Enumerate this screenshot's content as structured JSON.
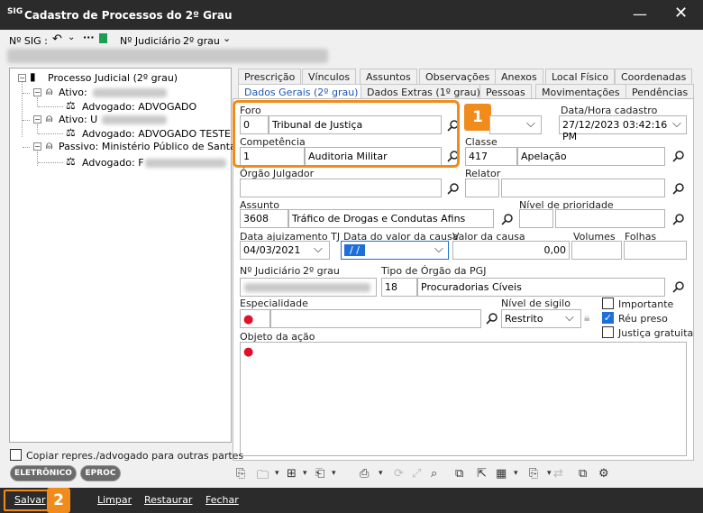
{
  "window": {
    "logo": "SIG",
    "title": "Cadastro de Processos do 2º Grau",
    "min": "—",
    "close": "✕"
  },
  "topbar": {
    "sig_label": "Nº SIG :",
    "judiciario_label": "Nº Judiciário",
    "grau_label": "2º grau"
  },
  "tree": {
    "root": "Processo Judicial (2º grau)",
    "ativo1": "Ativo:",
    "adv1": "Advogado: ADVOGADO",
    "ativo2": "Ativo: U",
    "adv2": "Advogado: ADVOGADO TESTE",
    "passivo": "Passivo: Ministério Público de Santa",
    "adv3": "Advogado: F"
  },
  "tabs_row1": [
    "Prescrição",
    "Vínculos",
    "Assuntos",
    "Observações",
    "Anexos",
    "Local Físico",
    "Coordenadas"
  ],
  "tabs_row2": [
    "Dados Gerais (2º grau)",
    "Dados Extras (1º grau)",
    "Pessoas",
    "Movimentações",
    "Pendências"
  ],
  "form": {
    "foro_label": "Foro",
    "foro_code": "0",
    "foro_name": "Tribunal de Justiça",
    "competencia_label": "Competência",
    "competencia_code": "1",
    "competencia_name": "Auditoria Militar",
    "datahora_label": "Data/Hora cadastro",
    "datahora_value": "27/12/2023 03:42:16 PM",
    "classe_label": "Classe",
    "classe_code": "417",
    "classe_name": "Apelação",
    "orgao_label": "Órgão Julgador",
    "relator_label": "Relator",
    "nivel_prioridade_label": "Nível de prioridade",
    "assunto_label": "Assunto",
    "assunto_code": "3608",
    "assunto_name": "Tráfico de Drogas e Condutas Afins",
    "data_ajuiz_label": "Data ajuizamento TJ",
    "data_ajuiz_value": "04/03/2021",
    "data_valor_label": "Data do valor da causa",
    "data_valor_value": "/ /",
    "valor_causa_label": "Valor da causa",
    "valor_causa_value": "0,00",
    "volumes_label": "Volumes",
    "folhas_label": "Folhas",
    "njud_label": "Nº Judiciário",
    "njud_grau": "2º grau",
    "tipo_orgao_label": "Tipo de Órgão da PGJ",
    "tipo_orgao_code": "18",
    "tipo_orgao_name": "Procuradorias Cíveis",
    "especialidade_label": "Especialidade",
    "nivel_sigilo_label": "Nível de sigilo",
    "nivel_sigilo_value": "Restrito",
    "importante_label": "Importante",
    "reu_preso_label": "Réu preso",
    "justica_gratuita_label": "Justiça gratuita",
    "objeto_label": "Objeto da ação",
    "required_mark": "●"
  },
  "copiar_label": "Copiar repres./advogado para outras partes",
  "pills": [
    "ELETRÔNICO",
    "EPROC"
  ],
  "badges": [
    "1",
    "2"
  ],
  "bottom": {
    "salvar": "Salvar",
    "limpar": "Limpar",
    "restaurar": "Restaurar",
    "fechar": "Fechar"
  }
}
